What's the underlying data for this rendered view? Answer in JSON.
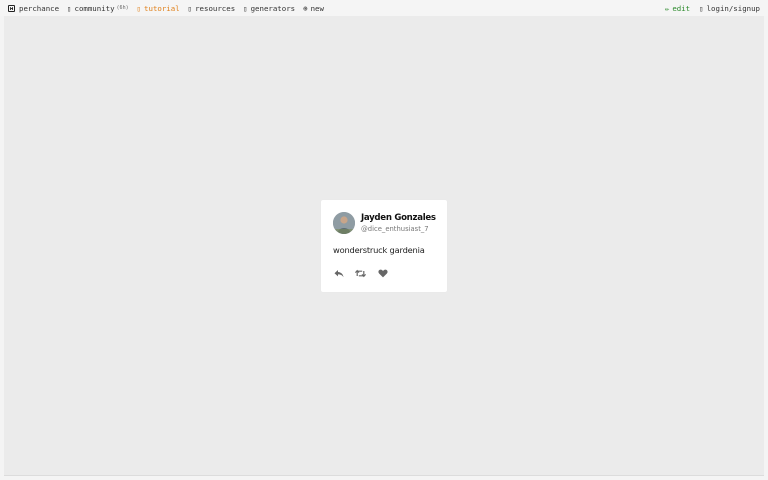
{
  "topbar": {
    "left": [
      {
        "label": "perchance",
        "icon": "die-icon"
      },
      {
        "label": "community",
        "count": "(6h)",
        "icon": "comment-icon"
      },
      {
        "label": "tutorial",
        "icon": "graduation-icon"
      },
      {
        "label": "resources",
        "icon": "book-icon"
      },
      {
        "label": "generators",
        "icon": "grid-icon"
      },
      {
        "label": "new",
        "icon": "plus-circle-icon",
        "glyph": "⊕"
      }
    ],
    "right": [
      {
        "label": "edit",
        "icon": "pencil-icon",
        "glyph": "✏"
      },
      {
        "label": "login/signup",
        "icon": "user-icon"
      }
    ]
  },
  "card": {
    "name": "Jayden Gonzales",
    "handle": "@dice_enthusiast_7",
    "text": "wonderstruck gardenia",
    "actions": [
      "reply-icon",
      "retweet-icon",
      "heart-icon"
    ]
  },
  "colors": {
    "tutorial": "#e0801a",
    "edit": "#2b8a2b",
    "stage": "#ebebeb"
  }
}
